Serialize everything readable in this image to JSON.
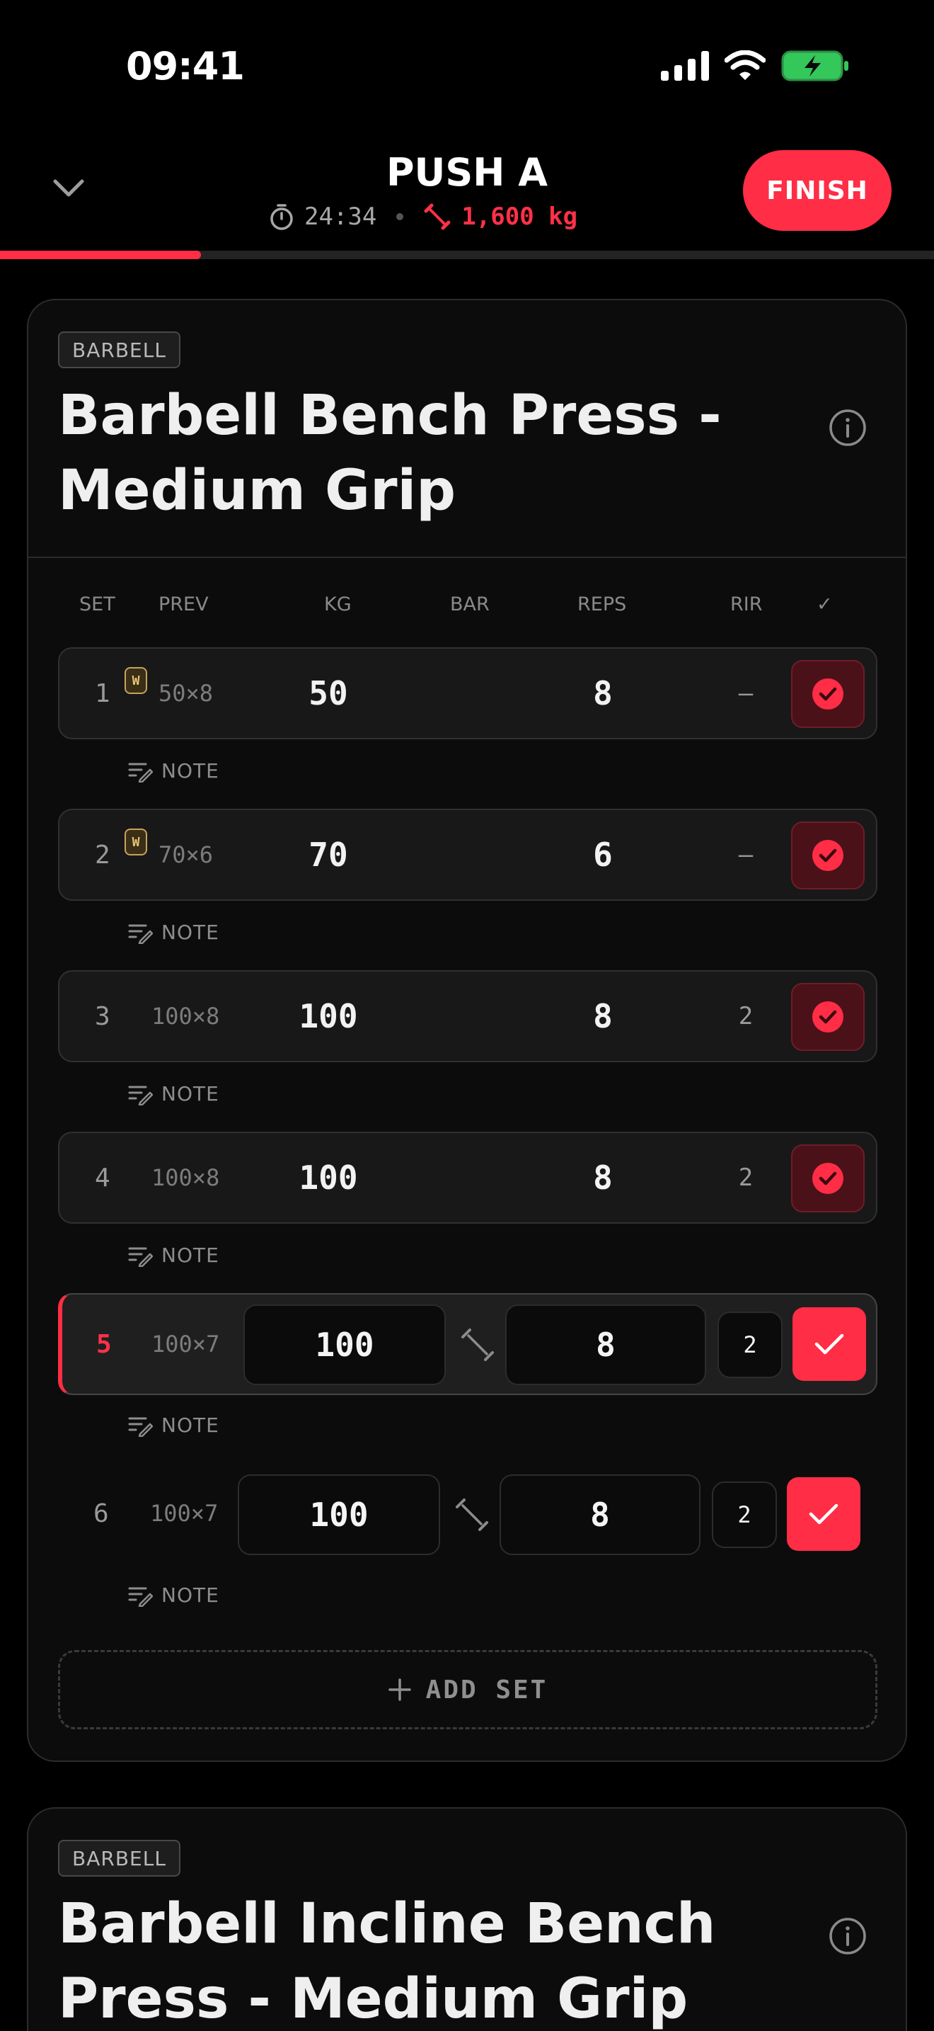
{
  "status_bar": {
    "time": "09:41"
  },
  "header": {
    "title": "PUSH A",
    "timer": "24:34",
    "volume": "1,600 kg",
    "finish_label": "FINISH",
    "progress": 0.215
  },
  "colors": {
    "accent": "#ff2d45",
    "background": "#000000",
    "card": "#0c0c0c",
    "warmup_badge": "#c8a25e"
  },
  "exercise1": {
    "equipment": "BARBELL",
    "name": "Barbell Bench Press - Medium Grip",
    "columns": {
      "set": "SET",
      "prev": "PREV",
      "kg": "KG",
      "bar": "BAR",
      "reps": "REPS",
      "rir": "RIR",
      "check": "✓"
    },
    "note_label": "NOTE",
    "warmup_badge": "W",
    "sets": [
      {
        "set": "1",
        "prev": "50×8",
        "kg": "50",
        "reps": "8",
        "rir": "–",
        "warmup": true,
        "state": "completed"
      },
      {
        "set": "2",
        "prev": "70×6",
        "kg": "70",
        "reps": "6",
        "rir": "–",
        "warmup": true,
        "state": "completed"
      },
      {
        "set": "3",
        "prev": "100×8",
        "kg": "100",
        "reps": "8",
        "rir": "2",
        "warmup": false,
        "state": "completed"
      },
      {
        "set": "4",
        "prev": "100×8",
        "kg": "100",
        "reps": "8",
        "rir": "2",
        "warmup": false,
        "state": "completed"
      },
      {
        "set": "5",
        "prev": "100×7",
        "kg": "100",
        "reps": "8",
        "rir": "2",
        "warmup": false,
        "state": "active"
      },
      {
        "set": "6",
        "prev": "100×7",
        "kg": "100",
        "reps": "8",
        "rir": "2",
        "warmup": false,
        "state": "pending"
      }
    ],
    "add_set_label": "ADD SET"
  },
  "exercise2": {
    "equipment": "BARBELL",
    "name": "Barbell Incline Bench Press - Medium Grip"
  },
  "icons": [
    "signal-icon",
    "wifi-icon",
    "battery-charging-icon",
    "chevron-down-icon",
    "stopwatch-icon",
    "dumbbell-icon",
    "info-icon",
    "check-circle-icon",
    "check-icon",
    "note-icon",
    "plus-icon"
  ]
}
